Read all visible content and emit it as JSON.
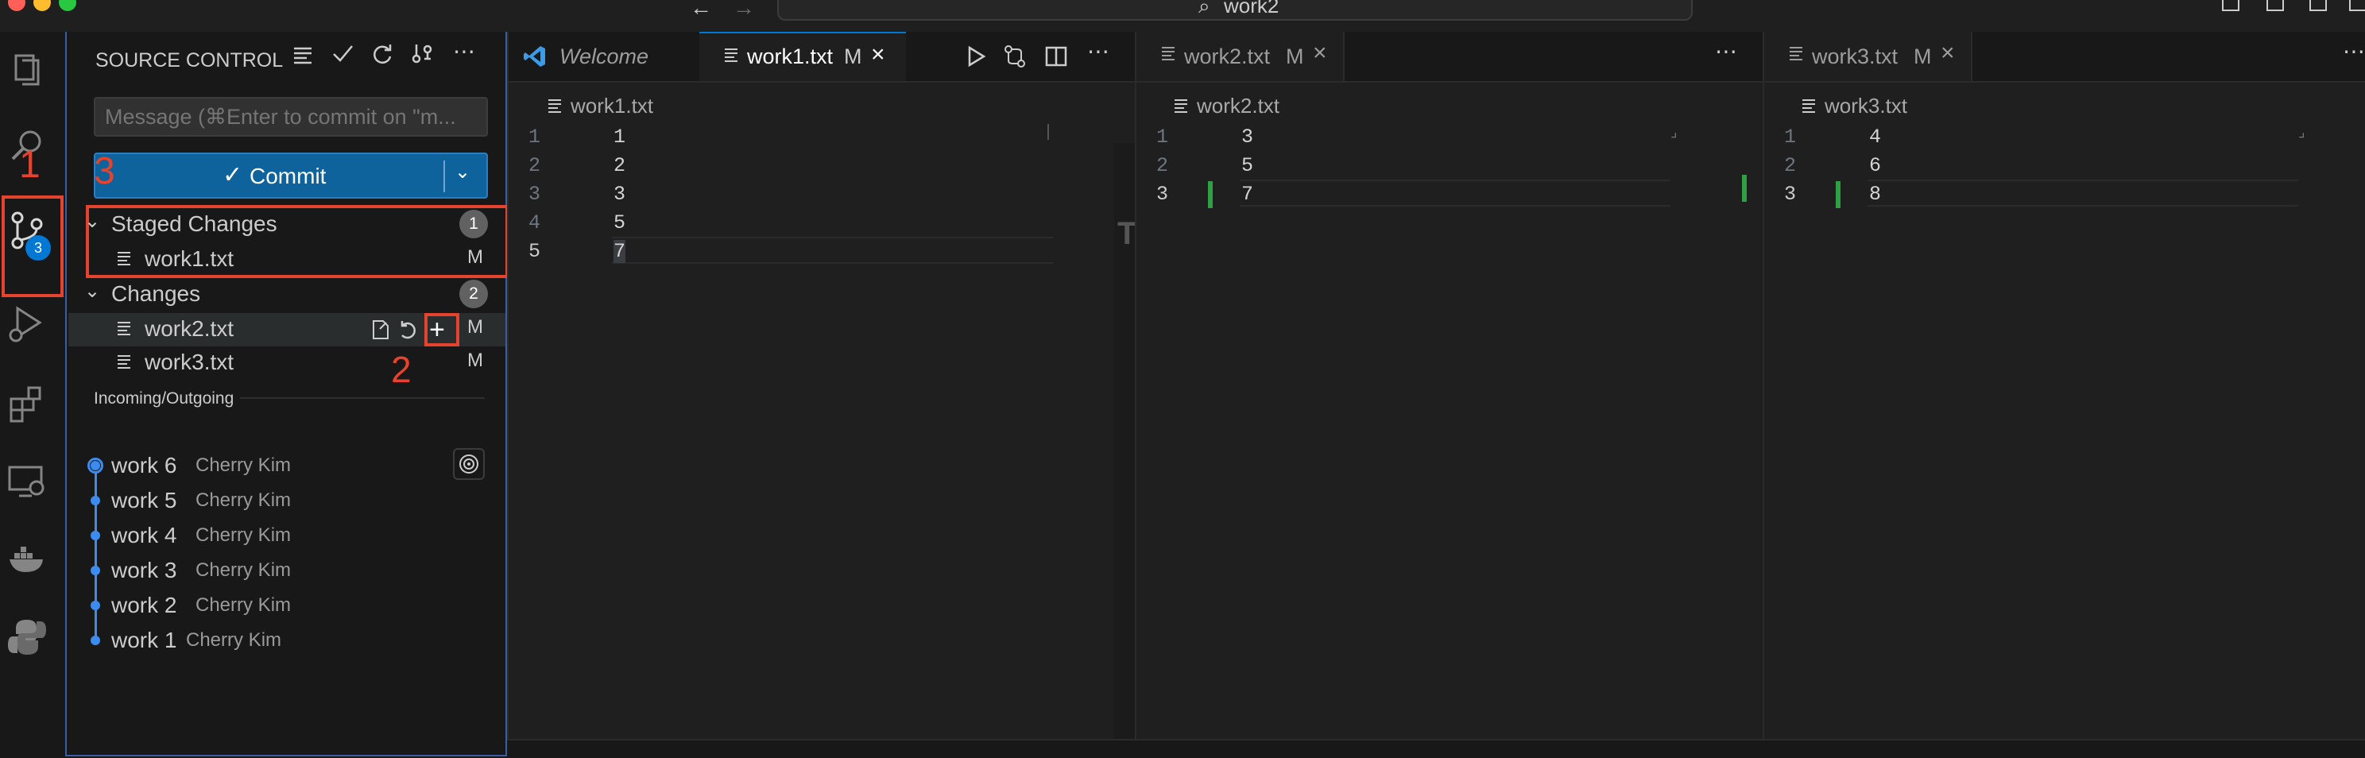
{
  "titlebar": {
    "search_text": "work2"
  },
  "activity_bar": {
    "scm_badge": "3",
    "items": [
      "explorer-icon",
      "search-icon",
      "source-control-icon",
      "run-debug-icon",
      "extensions-icon",
      "remote-explorer-icon",
      "docker-icon",
      "python-icon"
    ]
  },
  "annotations": {
    "one": "1",
    "two": "2",
    "three": "3"
  },
  "sidebar": {
    "title": "SOURCE CONTROL",
    "message_placeholder": "Message (⌘Enter to commit on \"m...",
    "commit_label": "Commit",
    "staged": {
      "label": "Staged Changes",
      "count": "1",
      "files": [
        {
          "name": "work1.txt",
          "status": "M"
        }
      ]
    },
    "changes": {
      "label": "Changes",
      "count": "2",
      "files": [
        {
          "name": "work2.txt",
          "status": "M"
        },
        {
          "name": "work3.txt",
          "status": "M"
        }
      ]
    },
    "incoming_outgoing": {
      "label": "Incoming/Outgoing",
      "commits": [
        {
          "message": "work 6",
          "author": "Cherry Kim"
        },
        {
          "message": "work 5",
          "author": "Cherry Kim"
        },
        {
          "message": "work 4",
          "author": "Cherry Kim"
        },
        {
          "message": "work 3",
          "author": "Cherry Kim"
        },
        {
          "message": "work 2",
          "author": "Cherry Kim"
        },
        {
          "message": "work 1",
          "author": "Cherry Kim"
        }
      ]
    }
  },
  "editor1": {
    "tabs": [
      {
        "label": "Welcome"
      },
      {
        "label": "work1.txt",
        "status": "M"
      }
    ],
    "breadcrumb": "work1.txt",
    "lines": [
      {
        "n": "1",
        "text": "1"
      },
      {
        "n": "2",
        "text": "2"
      },
      {
        "n": "3",
        "text": "3"
      },
      {
        "n": "4",
        "text": "5"
      },
      {
        "n": "5",
        "text": "7"
      }
    ]
  },
  "editor2": {
    "tab": {
      "label": "work2.txt",
      "status": "M"
    },
    "breadcrumb": "work2.txt",
    "lines": [
      {
        "n": "1",
        "text": "3"
      },
      {
        "n": "2",
        "text": "5"
      },
      {
        "n": "3",
        "text": "7"
      }
    ]
  },
  "editor3": {
    "tab": {
      "label": "work3.txt",
      "status": "M"
    },
    "breadcrumb": "work3.txt",
    "lines": [
      {
        "n": "1",
        "text": "4"
      },
      {
        "n": "2",
        "text": "6"
      },
      {
        "n": "3",
        "text": "8"
      }
    ]
  },
  "colors": {
    "accent": "#0078d4",
    "commit_button": "#0e639c",
    "annotation_red": "#e5432d",
    "graph_blue": "#3c8cf0",
    "gutter_green": "#2ea043"
  }
}
